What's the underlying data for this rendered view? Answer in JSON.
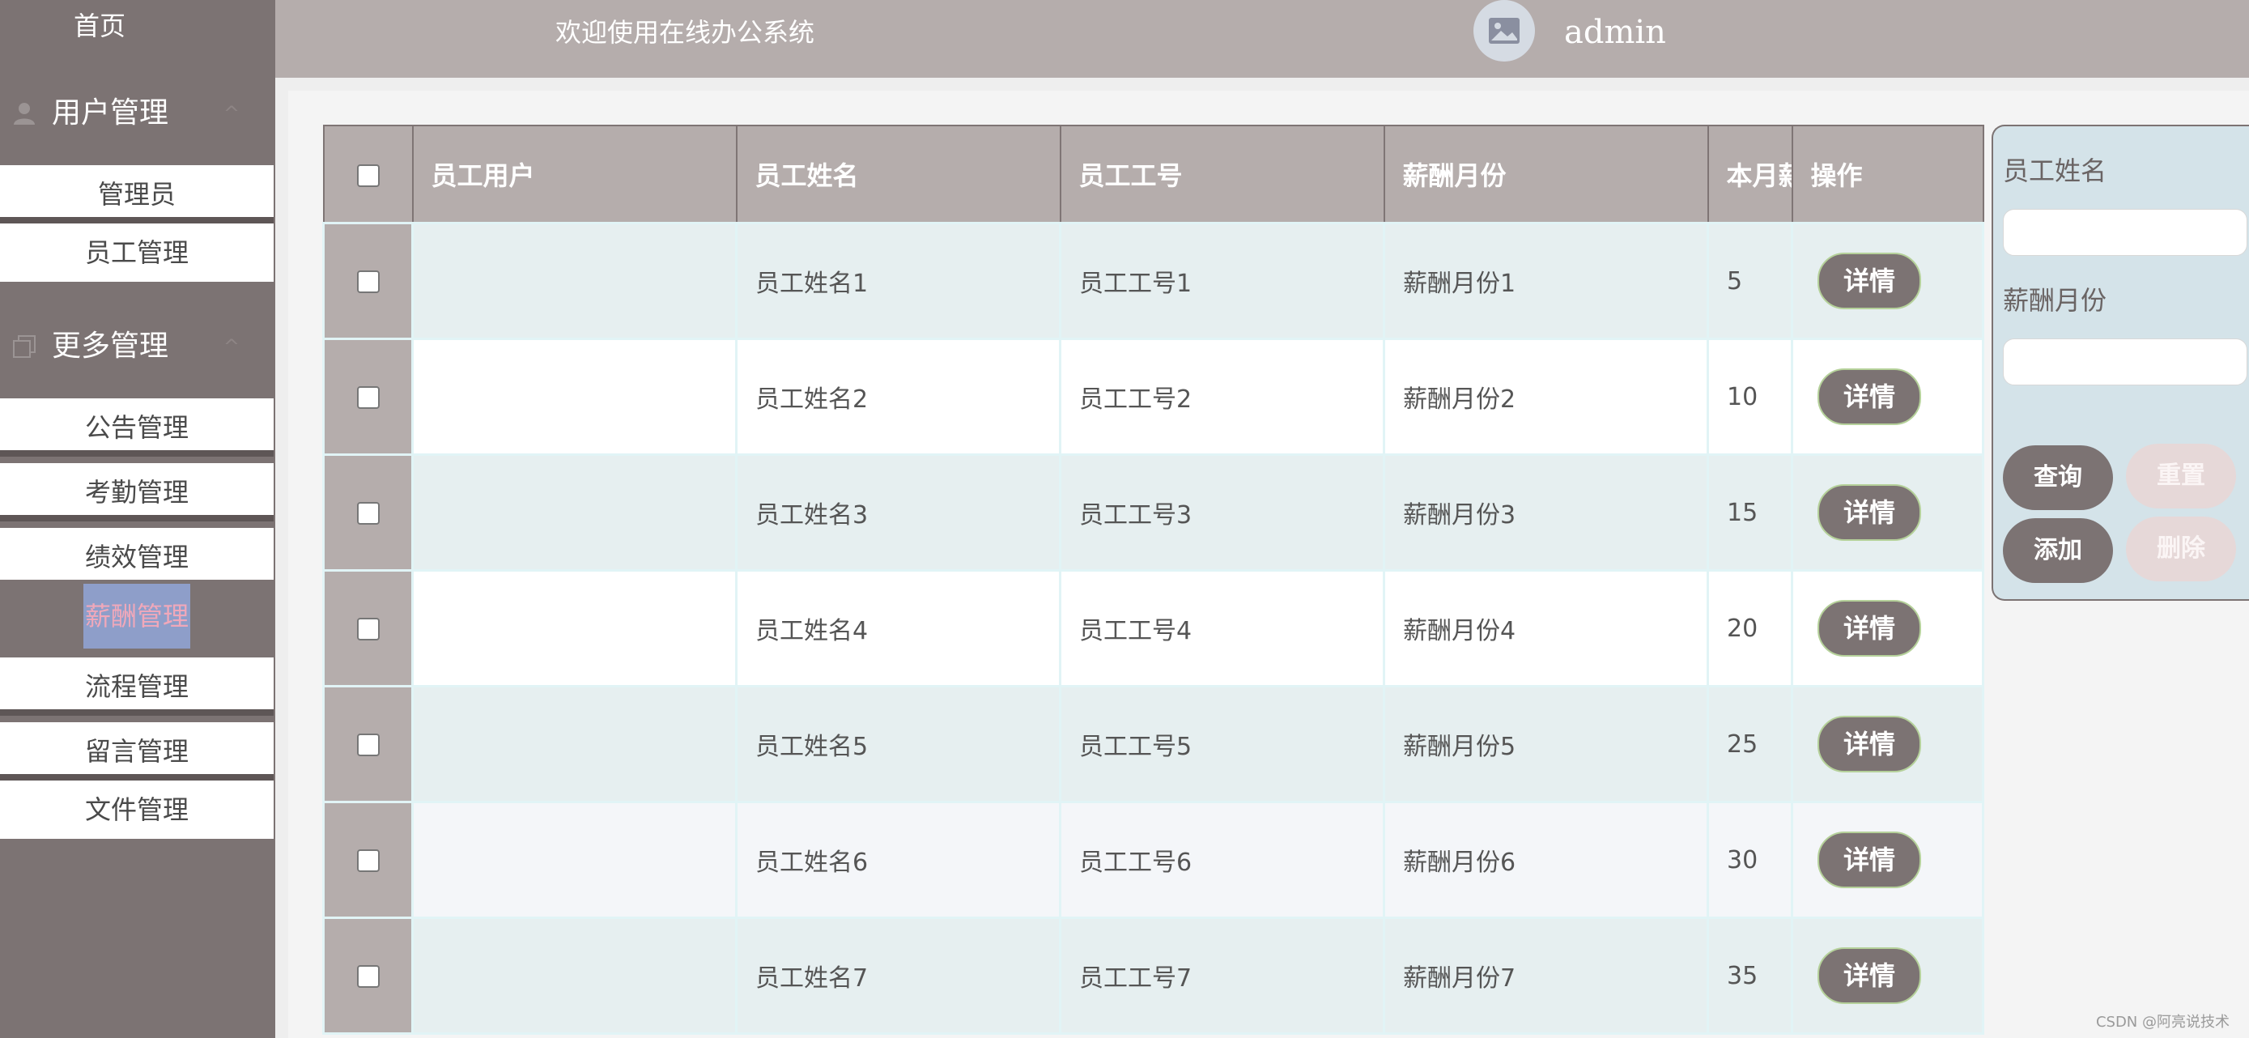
{
  "sidebar": {
    "home": "首页",
    "groups": [
      {
        "title": "用户管理",
        "icon": "user-icon",
        "items": [
          "管理员",
          "员工管理"
        ]
      },
      {
        "title": "更多管理",
        "icon": "copy-icon",
        "items": [
          "公告管理",
          "考勤管理",
          "绩效管理",
          "薪酬管理",
          "流程管理",
          "留言管理",
          "文件管理"
        ]
      }
    ],
    "active_item": "薪酬管理",
    "chevron": "^"
  },
  "header": {
    "welcome": "欢迎使用在线办公系统",
    "avatar_icon": "image-placeholder-icon",
    "username": "admin"
  },
  "table": {
    "columns": [
      "员工用户",
      "员工姓名",
      "员工工号",
      "薪酬月份",
      "本月薪",
      "操作"
    ],
    "rows": [
      {
        "user": "",
        "name": "员工姓名1",
        "id": "员工工号1",
        "month": "薪酬月份1",
        "salary": "5",
        "action": "详情"
      },
      {
        "user": "",
        "name": "员工姓名2",
        "id": "员工工号2",
        "month": "薪酬月份2",
        "salary": "10",
        "action": "详情"
      },
      {
        "user": "",
        "name": "员工姓名3",
        "id": "员工工号3",
        "month": "薪酬月份3",
        "salary": "15",
        "action": "详情"
      },
      {
        "user": "",
        "name": "员工姓名4",
        "id": "员工工号4",
        "month": "薪酬月份4",
        "salary": "20",
        "action": "详情"
      },
      {
        "user": "",
        "name": "员工姓名5",
        "id": "员工工号5",
        "month": "薪酬月份5",
        "salary": "25",
        "action": "详情"
      },
      {
        "user": "",
        "name": "员工姓名6",
        "id": "员工工号6",
        "month": "薪酬月份6",
        "salary": "30",
        "action": "详情"
      },
      {
        "user": "",
        "name": "员工姓名7",
        "id": "员工工号7",
        "month": "薪酬月份7",
        "salary": "35",
        "action": "详情"
      }
    ]
  },
  "search": {
    "name_label": "员工姓名",
    "name_value": "",
    "month_label": "薪酬月份",
    "month_value": "",
    "query": "查询",
    "reset": "重置",
    "add": "添加",
    "delete": "删除"
  },
  "watermark": "CSDN @阿亮说技术",
  "colors": {
    "sidebar": "#7c7373",
    "header": "#b5adac",
    "accent_active": "#f0a8ba",
    "panel": "#d4e3e9"
  }
}
